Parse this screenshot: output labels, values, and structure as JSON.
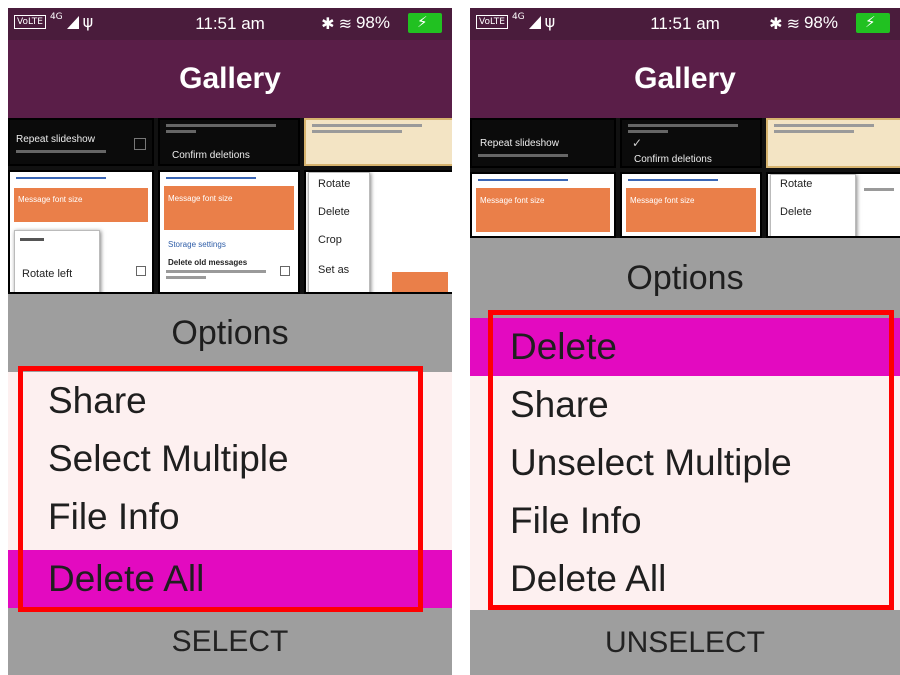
{
  "status_bar": {
    "volte": "VoLTE",
    "network": "4G",
    "time": "11:51 am",
    "battery": "98%",
    "icons": [
      "volte-icon",
      "signal-icon",
      "usb-icon",
      "bluetooth-icon",
      "data-icon",
      "battery-charging-icon"
    ]
  },
  "app": {
    "title": "Gallery"
  },
  "left_screen": {
    "thumbnails": {
      "repeat_slideshow": "Repeat slideshow",
      "confirm_deletions": "Confirm deletions",
      "rotate": "Rotate",
      "delete": "Delete",
      "crop": "Crop",
      "set_as": "Set as",
      "rotate_left": "Rotate left",
      "message_font_size": "Message font size",
      "storage_settings": "Storage settings",
      "delete_old_messages": "Delete old messages"
    },
    "options_title": "Options",
    "menu": [
      {
        "label": "Share"
      },
      {
        "label": "Select Multiple"
      },
      {
        "label": "File Info"
      },
      {
        "label": "Delete All"
      }
    ],
    "selected_index": 3,
    "softkey": "SELECT"
  },
  "right_screen": {
    "thumbnails": {
      "repeat_slideshow": "Repeat slideshow",
      "confirm_deletions": "Confirm deletions",
      "rotate": "Rotate",
      "delete": "Delete",
      "message_font_size": "Message font size"
    },
    "options_title": "Options",
    "menu": [
      {
        "label": "Delete"
      },
      {
        "label": "Share"
      },
      {
        "label": "Unselect Multiple"
      },
      {
        "label": "File Info"
      },
      {
        "label": "Delete All"
      }
    ],
    "selected_index": 0,
    "softkey": "UNSELECT"
  },
  "colors": {
    "status_bar": "#4a1c3c",
    "app_bar": "#5a1e48",
    "menu_bg": "#fdf0f0",
    "selected": "#e30ac0",
    "header_gray": "#9e9e9e",
    "highlight_outline": "#ff0000",
    "battery": "#21c121",
    "thumbnail_orange": "#ea7f49"
  }
}
